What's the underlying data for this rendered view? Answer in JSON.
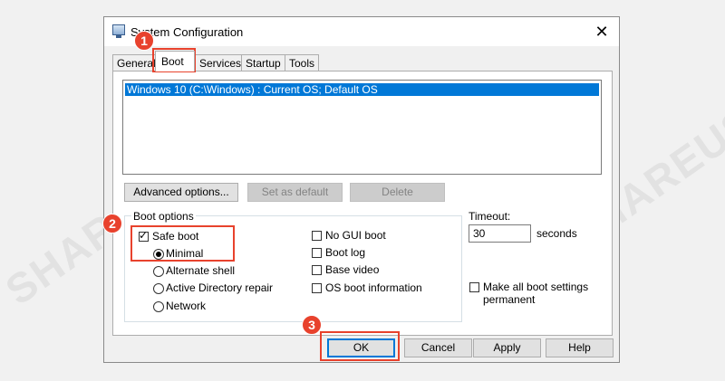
{
  "watermark": "SHAREUS",
  "window": {
    "title": "System Configuration",
    "close_glyph": "✕"
  },
  "tabs": [
    {
      "label": "General",
      "active": false
    },
    {
      "label": "Boot",
      "active": true
    },
    {
      "label": "Services",
      "active": false
    },
    {
      "label": "Startup",
      "active": false
    },
    {
      "label": "Tools",
      "active": false
    }
  ],
  "boot_list": {
    "entries": [
      "Windows 10 (C:\\Windows) : Current OS; Default OS"
    ]
  },
  "boot_buttons": {
    "advanced": "Advanced options...",
    "set_default": "Set as default",
    "delete": "Delete"
  },
  "boot_options": {
    "group_label": "Boot options",
    "safe_boot": {
      "label": "Safe boot",
      "checked": true
    },
    "modes": [
      {
        "label": "Minimal",
        "selected": true
      },
      {
        "label": "Alternate shell",
        "selected": false
      },
      {
        "label": "Active Directory repair",
        "selected": false
      },
      {
        "label": "Network",
        "selected": false
      }
    ],
    "right_checks": [
      {
        "label": "No GUI boot",
        "checked": false
      },
      {
        "label": "Boot log",
        "checked": false
      },
      {
        "label": "Base video",
        "checked": false
      },
      {
        "label": "OS boot information",
        "checked": false
      }
    ]
  },
  "timeout": {
    "label": "Timeout:",
    "value": "30",
    "unit": "seconds"
  },
  "permanent": {
    "label_line1": "Make all boot settings",
    "label_line2": "permanent",
    "checked": false
  },
  "footer": {
    "ok": "OK",
    "cancel": "Cancel",
    "apply": "Apply",
    "help": "Help"
  },
  "annotations": {
    "badge_1": "1",
    "badge_2": "2",
    "badge_3": "3",
    "color": "#e8422d"
  },
  "colors": {
    "selection": "#0078d7",
    "accent_annotation": "#e8422d"
  }
}
